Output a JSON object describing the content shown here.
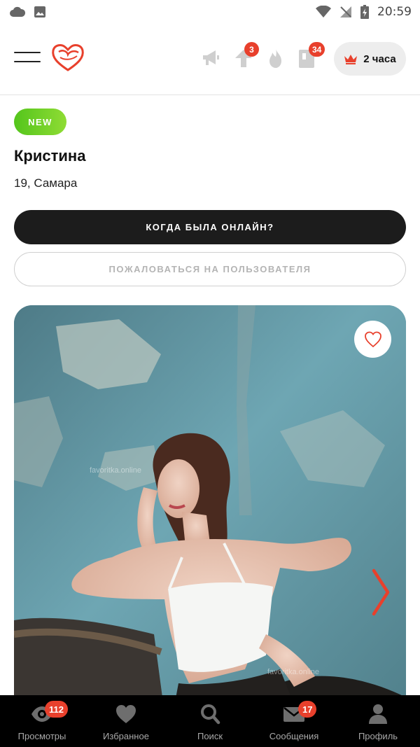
{
  "status_bar": {
    "time": "20:59",
    "icons": [
      "cloud-icon",
      "image-icon",
      "wifi-icon",
      "no-sim-icon",
      "battery-charging-icon"
    ]
  },
  "header": {
    "menu_icon": "hamburger-icon",
    "logo_icon": "heart-logo-icon",
    "icons": [
      {
        "name": "megaphone-icon",
        "badge": ""
      },
      {
        "name": "boost-up-icon",
        "badge": "3"
      },
      {
        "name": "fire-icon",
        "badge": ""
      },
      {
        "name": "guest-book-icon",
        "badge": "34"
      }
    ],
    "premium": {
      "icon": "crown-icon",
      "label": "2 часа",
      "icon_color": "#e8402c"
    }
  },
  "profile": {
    "badge": "NEW",
    "name": "Кристина",
    "age_city": "19, Самара",
    "online_button": "КОГДА БЫЛА ОНЛАЙН?",
    "report_button": "ПОЖАЛОВАТЬСЯ НА ПОЛЬЗОВАТЕЛЯ"
  },
  "photo": {
    "like_icon": "heart-outline-icon",
    "next_icon": "chevron-right-icon",
    "watermark_top": "favoritka.online",
    "watermark_bottom": "favoritka.online"
  },
  "bottom_nav": [
    {
      "icon": "eye-icon",
      "label": "Просмотры",
      "badge": "112"
    },
    {
      "icon": "heart-icon",
      "label": "Избранное",
      "badge": ""
    },
    {
      "icon": "search-icon",
      "label": "Поиск",
      "badge": ""
    },
    {
      "icon": "mail-icon",
      "label": "Сообщения",
      "badge": "17"
    },
    {
      "icon": "user-icon",
      "label": "Профиль",
      "badge": ""
    }
  ],
  "colors": {
    "accent_red": "#e8402c",
    "new_green": "#6fd02a",
    "dark_button": "#1c1c1c",
    "nav_bg": "#000000"
  }
}
